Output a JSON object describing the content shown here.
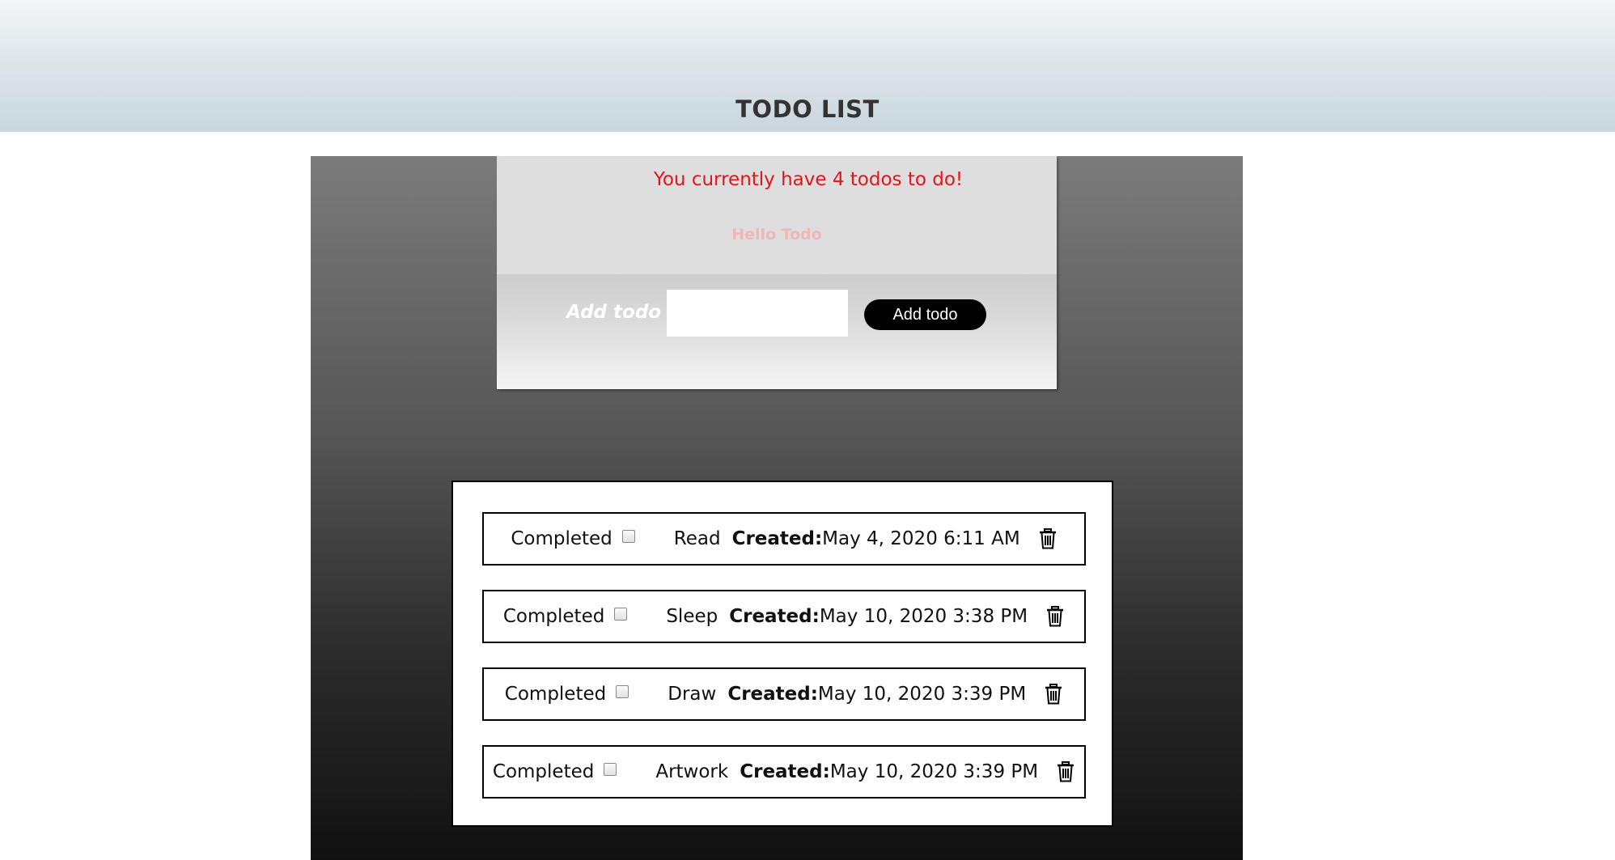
{
  "header": {
    "title": "TODO LIST"
  },
  "summary": {
    "message": "You currently have 4 todos to do!",
    "greeting": "Hello Todo"
  },
  "add_form": {
    "label": "Add todo :",
    "input_value": "",
    "button_label": "Add todo"
  },
  "todos": [
    {
      "completed_label": "Completed",
      "completed": false,
      "name": "Read",
      "created_label": "Created:",
      "created": "May 4, 2020 6:11 AM",
      "delete_icon": "trash-icon"
    },
    {
      "completed_label": "Completed",
      "completed": false,
      "name": "Sleep",
      "created_label": "Created:",
      "created": "May 10, 2020 3:38 PM",
      "delete_icon": "trash-icon"
    },
    {
      "completed_label": "Completed",
      "completed": false,
      "name": "Draw",
      "created_label": "Created:",
      "created": "May 10, 2020 3:39 PM",
      "delete_icon": "trash-icon"
    },
    {
      "completed_label": "Completed",
      "completed": false,
      "name": "Artwork",
      "created_label": "Created:",
      "created": "May 10, 2020 3:39 PM",
      "delete_icon": "trash-icon"
    }
  ],
  "colors": {
    "count_message": "#e3141b",
    "greeting": "#f3b5b5",
    "button_bg": "#000000"
  }
}
